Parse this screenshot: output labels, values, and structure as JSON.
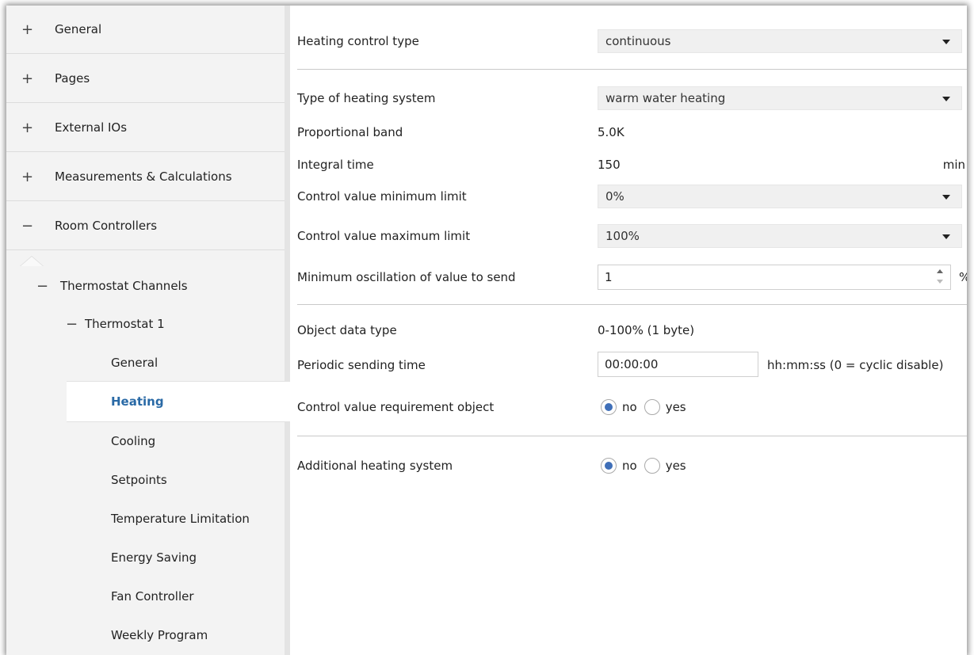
{
  "sidebar": {
    "sections": [
      {
        "symbol": "+",
        "label": "General"
      },
      {
        "symbol": "+",
        "label": "Pages"
      },
      {
        "symbol": "+",
        "label": "External IOs"
      },
      {
        "symbol": "+",
        "label": "Measurements & Calculations"
      },
      {
        "symbol": "−",
        "label": "Room Controllers"
      }
    ],
    "tree": {
      "group": {
        "symbol": "−",
        "label": "Thermostat Channels"
      },
      "channel": {
        "symbol": "−",
        "label": "Thermostat 1"
      },
      "pages": [
        "General",
        "Heating",
        "Cooling",
        "Setpoints",
        "Temperature Limitation",
        "Energy Saving",
        "Fan Controller",
        "Weekly Program"
      ],
      "active_page": "Heating"
    }
  },
  "form": {
    "heating_control_type": {
      "label": "Heating control type",
      "value": "continuous"
    },
    "heating_system_type": {
      "label": "Type of heating system",
      "value": "warm water heating"
    },
    "proportional_band": {
      "label": "Proportional band",
      "value": "5.0K"
    },
    "integral_time": {
      "label": "Integral time",
      "value": "150",
      "unit": "min"
    },
    "min_limit": {
      "label": "Control value minimum limit",
      "value": "0%"
    },
    "max_limit": {
      "label": "Control value maximum limit",
      "value": "100%"
    },
    "min_oscillation": {
      "label": "Minimum oscillation of value to send",
      "value": "1",
      "unit": "%"
    },
    "object_data_type": {
      "label": "Object data type",
      "value": "0-100% (1 byte)"
    },
    "periodic_sending": {
      "label": "Periodic sending time",
      "value": "00:00:00",
      "hint": "hh:mm:ss (0 = cyclic disable)"
    },
    "requirement_object": {
      "label": "Control value requirement object",
      "options": [
        "no",
        "yes"
      ],
      "selected": "no"
    },
    "additional_heating": {
      "label": "Additional heating system",
      "options": [
        "no",
        "yes"
      ],
      "selected": "no"
    }
  }
}
